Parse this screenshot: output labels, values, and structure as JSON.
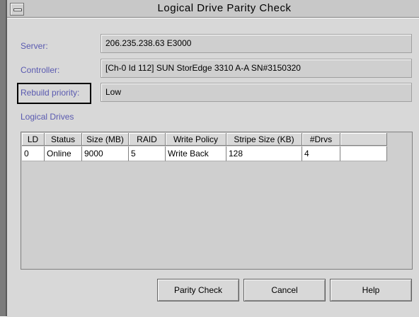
{
  "window": {
    "title": "Logical Drive Parity Check"
  },
  "form": {
    "server_label": "Server:",
    "server_value": "206.235.238.63 E3000",
    "controller_label": "Controller:",
    "controller_value": "[Ch-0 Id 112] SUN StorEdge 3310 A-A SN#3150320",
    "rebuild_label": "Rebuild priority:",
    "rebuild_value": "Low"
  },
  "section": {
    "logical_drives_label": "Logical Drives"
  },
  "table": {
    "headers": [
      "LD",
      "Status",
      "Size (MB)",
      "RAID",
      "Write Policy",
      "Stripe Size (KB)",
      "#Drvs",
      ""
    ],
    "rows": [
      [
        "0",
        "Online",
        "9000",
        "5",
        "Write Back",
        "128",
        "4",
        ""
      ]
    ]
  },
  "buttons": {
    "parity_check": "Parity Check",
    "cancel": "Cancel",
    "help": "Help"
  }
}
